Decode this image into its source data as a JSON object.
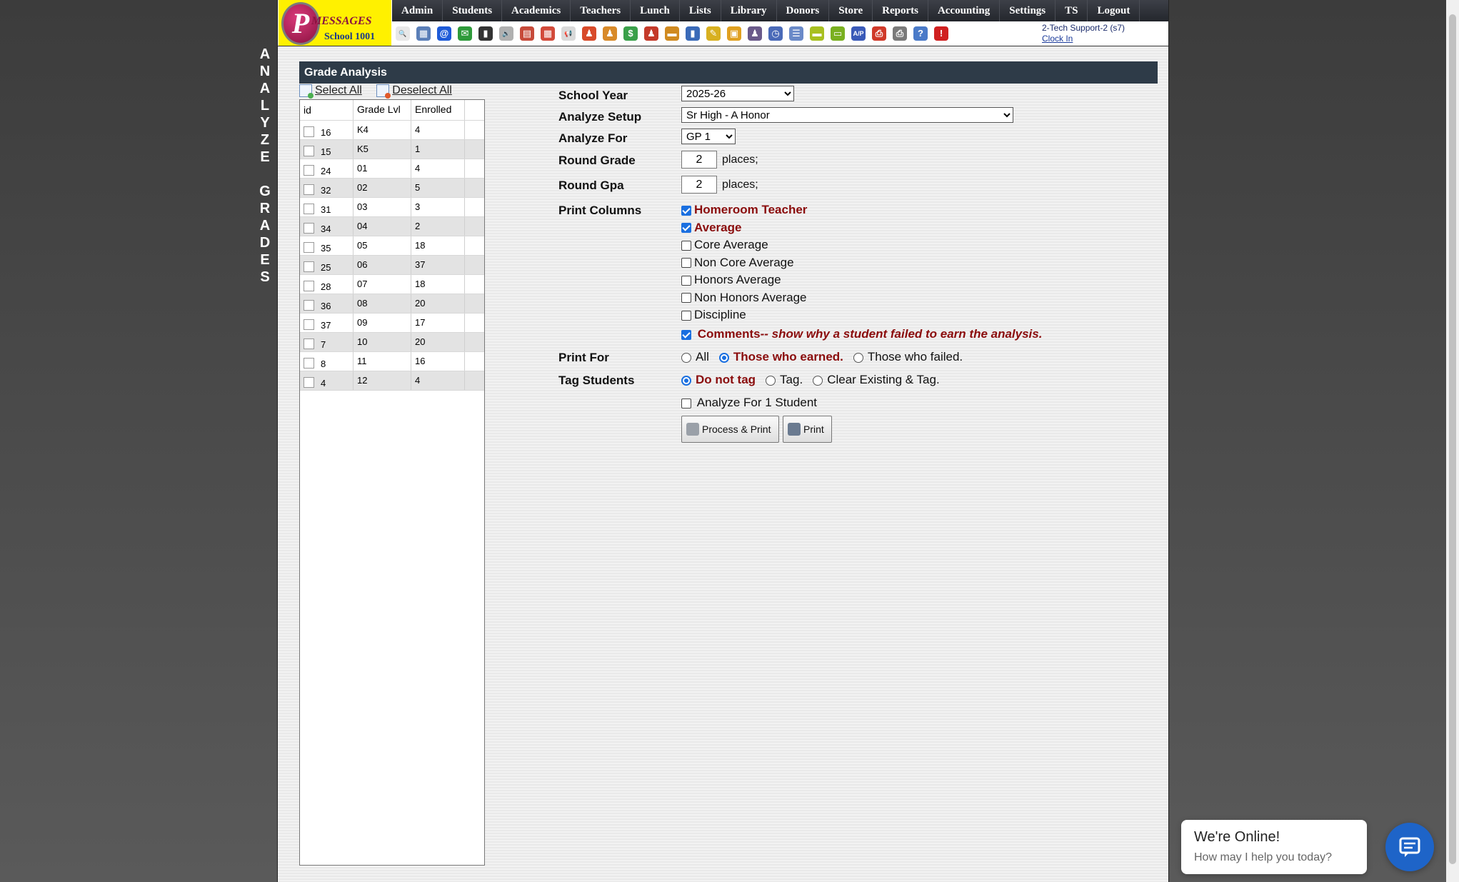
{
  "vertical_title": "ANALYZE GRADES",
  "logo": {
    "brand": "MESSAGES",
    "initial": "P",
    "school": "School 1001"
  },
  "nav": [
    "Admin",
    "Students",
    "Academics",
    "Teachers",
    "Lunch",
    "Lists",
    "Library",
    "Donors",
    "Store",
    "Reports",
    "Accounting",
    "Settings",
    "TS",
    "Logout"
  ],
  "toolbar_icons": [
    {
      "name": "search-icon",
      "glyph": "🔍",
      "color": "#e8e8e8"
    },
    {
      "name": "grid-icon",
      "glyph": "▦",
      "color": "#5b7fb8"
    },
    {
      "name": "at-icon",
      "glyph": "@",
      "color": "#1e5bd8"
    },
    {
      "name": "chat-icon",
      "glyph": "✉",
      "color": "#2e9a3a"
    },
    {
      "name": "phone-icon",
      "glyph": "▮",
      "color": "#333"
    },
    {
      "name": "speaker-icon",
      "glyph": "🔊",
      "color": "#b0b0b0"
    },
    {
      "name": "report-icon",
      "glyph": "▤",
      "color": "#c74a3a"
    },
    {
      "name": "calendar-icon",
      "glyph": "▦",
      "color": "#d24a3a"
    },
    {
      "name": "megaphone-icon",
      "glyph": "📢",
      "color": "#d9d9d9"
    },
    {
      "name": "person-icon",
      "glyph": "♟",
      "color": "#d84a2a"
    },
    {
      "name": "person2-icon",
      "glyph": "♟",
      "color": "#d88a2a"
    },
    {
      "name": "money-icon",
      "glyph": "$",
      "color": "#3aa04a"
    },
    {
      "name": "people-icon",
      "glyph": "♟",
      "color": "#c43a2a"
    },
    {
      "name": "lunch-icon",
      "glyph": "▬",
      "color": "#d08a20"
    },
    {
      "name": "book-icon",
      "glyph": "▮",
      "color": "#3a6ab8"
    },
    {
      "name": "sweep-icon",
      "glyph": "✎",
      "color": "#d8b020"
    },
    {
      "name": "store-icon",
      "glyph": "▣",
      "color": "#e0a020"
    },
    {
      "name": "staff-icon",
      "glyph": "♟",
      "color": "#6a5a8a"
    },
    {
      "name": "clock-icon",
      "glyph": "◷",
      "color": "#4a6ab8"
    },
    {
      "name": "list-icon",
      "glyph": "☰",
      "color": "#6a8ac8"
    },
    {
      "name": "card-icon",
      "glyph": "▬",
      "color": "#a8c020"
    },
    {
      "name": "bus-icon",
      "glyph": "▭",
      "color": "#7ab020"
    },
    {
      "name": "ap-icon",
      "glyph": "A/P",
      "color": "#3a5ab8"
    },
    {
      "name": "pdf-icon",
      "glyph": "⎙",
      "color": "#d03a2a"
    },
    {
      "name": "print-icon",
      "glyph": "⎙",
      "color": "#7a7a7a"
    },
    {
      "name": "help-icon",
      "glyph": "?",
      "color": "#4a7ac8"
    },
    {
      "name": "stop-icon",
      "glyph": "!",
      "color": "#d02020"
    }
  ],
  "user": {
    "name": "2-Tech Support-2 (s7)",
    "clock_in": "Clock In"
  },
  "section_title": "Grade Analysis",
  "select_all": "Select All",
  "deselect_all": "Deselect All",
  "grade_table": {
    "headers": [
      "id",
      "Grade Lvl",
      "Enrolled"
    ],
    "rows": [
      {
        "id": "16",
        "grade": "K4",
        "enrolled": "4"
      },
      {
        "id": "15",
        "grade": "K5",
        "enrolled": "1"
      },
      {
        "id": "24",
        "grade": "01",
        "enrolled": "4"
      },
      {
        "id": "32",
        "grade": "02",
        "enrolled": "5"
      },
      {
        "id": "31",
        "grade": "03",
        "enrolled": "3"
      },
      {
        "id": "34",
        "grade": "04",
        "enrolled": "2"
      },
      {
        "id": "35",
        "grade": "05",
        "enrolled": "18"
      },
      {
        "id": "25",
        "grade": "06",
        "enrolled": "37"
      },
      {
        "id": "28",
        "grade": "07",
        "enrolled": "18"
      },
      {
        "id": "36",
        "grade": "08",
        "enrolled": "20"
      },
      {
        "id": "37",
        "grade": "09",
        "enrolled": "17"
      },
      {
        "id": "7",
        "grade": "10",
        "enrolled": "20"
      },
      {
        "id": "8",
        "grade": "11",
        "enrolled": "16"
      },
      {
        "id": "4",
        "grade": "12",
        "enrolled": "4"
      }
    ]
  },
  "form": {
    "school_year_label": "School Year",
    "school_year_value": "2025-26",
    "analyze_setup_label": "Analyze Setup",
    "analyze_setup_value": "Sr High - A Honor",
    "analyze_for_label": "Analyze For",
    "analyze_for_value": "GP 1",
    "round_grade_label": "Round Grade",
    "round_grade_value": "2",
    "round_gpa_label": "Round Gpa",
    "round_gpa_value": "2",
    "places": "places;",
    "print_columns_label": "Print Columns",
    "columns": [
      {
        "label": "Homeroom Teacher",
        "checked": true
      },
      {
        "label": "Average",
        "checked": true
      },
      {
        "label": "Core Average",
        "checked": false
      },
      {
        "label": "Non Core Average",
        "checked": false
      },
      {
        "label": "Honors Average",
        "checked": false
      },
      {
        "label": "Non Honors Average",
        "checked": false
      },
      {
        "label": "Discipline",
        "checked": false
      }
    ],
    "comments_label": "Comments",
    "comments_note": "-- show why a student failed to earn the analysis.",
    "print_for_label": "Print For",
    "print_for_options": [
      "All",
      "Those who earned.",
      "Those who failed."
    ],
    "print_for_selected": 1,
    "tag_label": "Tag Students",
    "tag_options": [
      "Do not tag",
      "Tag.",
      "Clear Existing & Tag."
    ],
    "tag_selected": 0,
    "single_student_label": "Analyze For 1 Student",
    "process_print_button": "Process & Print",
    "print_button": "Print"
  },
  "chat": {
    "title": "We're Online!",
    "subtitle": "How may I help you today?"
  }
}
